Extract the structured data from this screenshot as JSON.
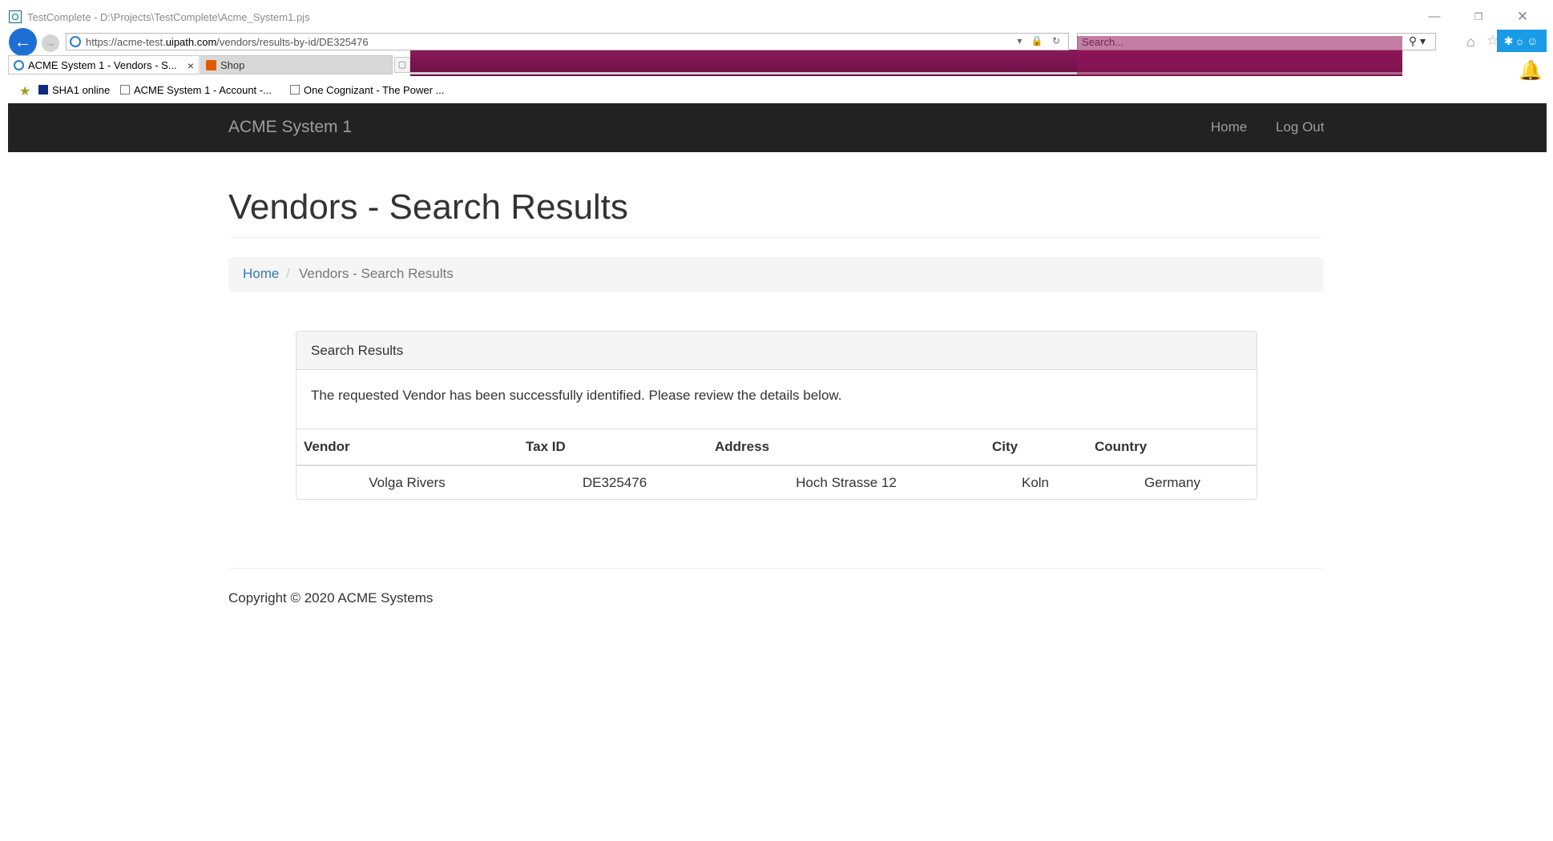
{
  "window": {
    "title": "TestComplete - D:\\Projects\\TestComplete\\Acme_System1.pjs",
    "minimize": "—",
    "restore": "❐",
    "close": "✕"
  },
  "browser": {
    "url_prefix": "https://acme-test.",
    "url_domain": "uipath.com",
    "url_path": "/vendors/results-by-id/DE325476",
    "address_icons": "▾ 🔒 ↻",
    "search_placeholder": "Search...",
    "search_icon": "⚲ ▾",
    "home_icon": "⌂",
    "star_icon": "☆",
    "notif_badge": "✱☼☺",
    "bell_icon": "🔔",
    "tabs": [
      {
        "label": "ACME System 1 - Vendors - S...",
        "close": "×"
      },
      {
        "label": "Shop"
      }
    ],
    "new_tab": "▢",
    "favorites_star": "★",
    "favorites": [
      {
        "label": "SHA1 online"
      },
      {
        "label": "ACME System 1 - Account -..."
      },
      {
        "label": "One Cognizant - The Power ..."
      }
    ]
  },
  "navbar": {
    "brand": "ACME System 1",
    "links": {
      "home": "Home",
      "logout": "Log Out"
    }
  },
  "page": {
    "title": "Vendors - Search Results",
    "breadcrumb": {
      "home": "Home",
      "separator": "/",
      "current": "Vendors - Search Results"
    }
  },
  "panel": {
    "title": "Search Results",
    "message": "The requested Vendor has been successfully identified. Please review the details below.",
    "table": {
      "headers": {
        "vendor": "Vendor",
        "tax_id": "Tax ID",
        "address": "Address",
        "city": "City",
        "country": "Country"
      },
      "rows": [
        {
          "vendor": "Volga Rivers",
          "tax_id": "DE325476",
          "address": "Hoch Strasse 12",
          "city": "Koln",
          "country": "Germany"
        }
      ]
    }
  },
  "footer": {
    "copyright": "Copyright © 2020 ACME Systems"
  },
  "colors": {
    "navbar_bg": "#222222",
    "link": "#337ab7",
    "overlay_magenta": "#8a1a5a",
    "back_button": "#1e6fd3"
  }
}
